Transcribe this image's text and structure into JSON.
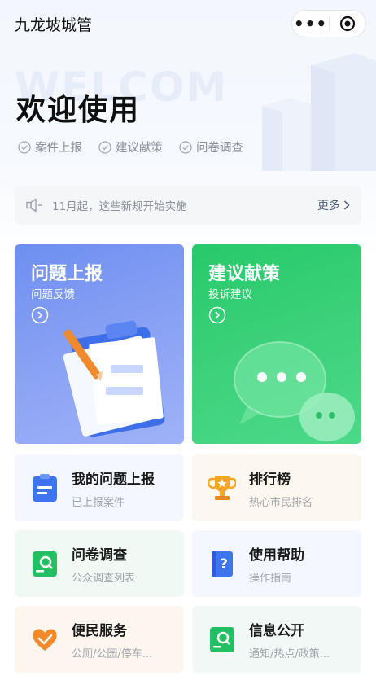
{
  "header": {
    "title": "九龙坡城管",
    "more_glyph": "•••"
  },
  "hero": {
    "watermark": "WELCOM",
    "title": "欢迎使用",
    "tags": [
      "案件上报",
      "建议献策",
      "问卷调查"
    ]
  },
  "notice": {
    "text": "11月起，这些新规开始实施",
    "more_label": "更多"
  },
  "cards": [
    {
      "title": "问题上报",
      "subtitle": "问题反馈",
      "color": "#7393f1"
    },
    {
      "title": "建议献策",
      "subtitle": "投诉建议",
      "color": "#2fcc72"
    }
  ],
  "tiles": [
    {
      "title": "我的问题上报",
      "subtitle": "已上报案件",
      "icon": "clipboard-icon"
    },
    {
      "title": "排行榜",
      "subtitle": "热心市民排名",
      "icon": "trophy-icon"
    },
    {
      "title": "问卷调查",
      "subtitle": "公众调查列表",
      "icon": "survey-icon"
    },
    {
      "title": "使用帮助",
      "subtitle": "操作指南",
      "icon": "help-book-icon"
    },
    {
      "title": "便民服务",
      "subtitle": "公厕/公园/停车...",
      "icon": "heart-hands-icon"
    },
    {
      "title": "信息公开",
      "subtitle": "通知/热点/政策...",
      "icon": "info-search-icon"
    }
  ],
  "colors": {
    "accent_blue": "#3f74f0",
    "accent_green": "#22c063",
    "accent_orange": "#f08a2c"
  }
}
